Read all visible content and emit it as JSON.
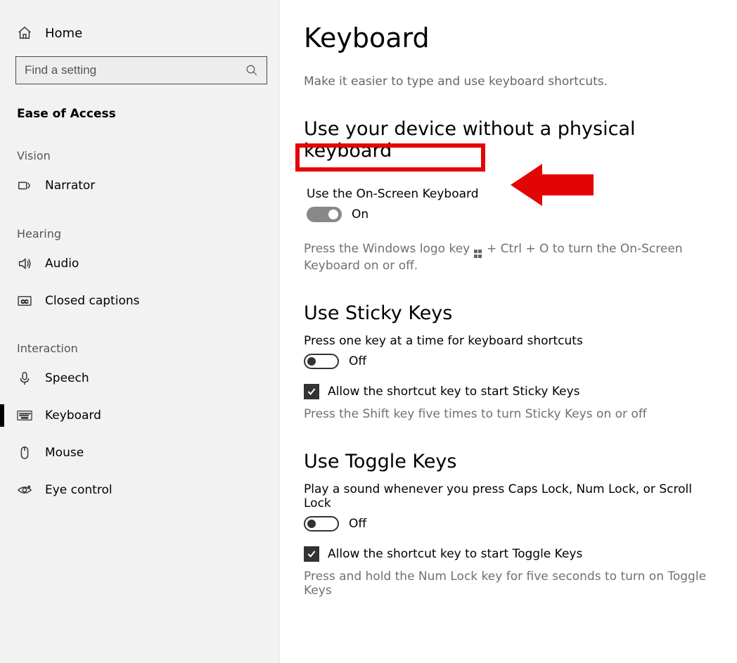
{
  "sidebar": {
    "homeLabel": "Home",
    "searchPlaceholder": "Find a setting",
    "categoryTitle": "Ease of Access",
    "groups": {
      "vision": "Vision",
      "hearing": "Hearing",
      "interaction": "Interaction"
    },
    "items": {
      "narrator": "Narrator",
      "audio": "Audio",
      "captions": "Closed captions",
      "speech": "Speech",
      "keyboard": "Keyboard",
      "mouse": "Mouse",
      "eyecontrol": "Eye control"
    }
  },
  "main": {
    "title": "Keyboard",
    "subtitle": "Make it easier to type and use keyboard shortcuts.",
    "s1": {
      "heading": "Use your device without a physical keyboard",
      "optLabel": "Use the On-Screen Keyboard",
      "toggleState": "On",
      "hintA": "Press the Windows logo key ",
      "hintB": " + Ctrl + O to turn the On-Screen Keyboard on or off."
    },
    "s2": {
      "heading": "Use Sticky Keys",
      "desc": "Press one key at a time for keyboard shortcuts",
      "toggleState": "Off",
      "checkLabel": "Allow the shortcut key to start Sticky Keys",
      "note": "Press the Shift key five times to turn Sticky Keys on or off"
    },
    "s3": {
      "heading": "Use Toggle Keys",
      "desc": "Play a sound whenever you press Caps Lock, Num Lock, or Scroll Lock",
      "toggleState": "Off",
      "checkLabel": "Allow the shortcut key to start Toggle Keys",
      "note": "Press and hold the Num Lock key for five seconds to turn on Toggle Keys"
    }
  }
}
